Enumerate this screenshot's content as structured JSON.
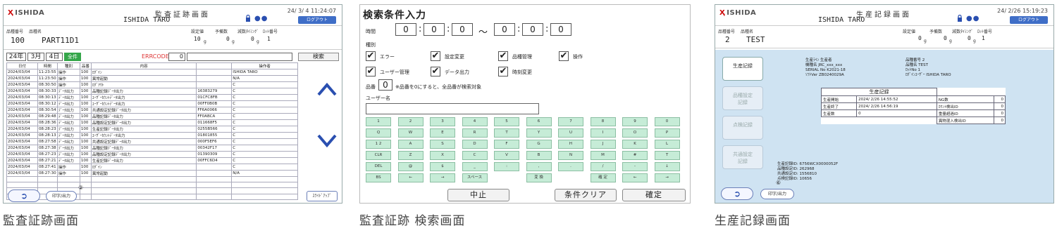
{
  "panels": {
    "audit": {
      "logo": "ISHIDA",
      "title": "監査証跡画面",
      "datetime": "24/ 3/ 4 11:24:07",
      "user": "ISHIDA TARO",
      "logout": "ログアウト",
      "header_labels": {
        "item_no": "品種番号",
        "item_name": "品種名",
        "set_weight": "設定値",
        "target": "予備数",
        "reduce": "減数ﾀｲﾐﾝｸﾞ",
        "lot": "ﾛｯﾄ番号"
      },
      "header_values": {
        "item_no": "100",
        "item_name": "PART11D1",
        "set_weight": "10",
        "target": "0",
        "reduce": "0",
        "lot": "1"
      },
      "unit": "g",
      "filter": {
        "year": "24年",
        "month": "3月",
        "day": "4日",
        "tag": "全件",
        "errcode_label": "ERRCODE",
        "errcode_value": "0",
        "search": "検索"
      },
      "columns": [
        "日付",
        "時間",
        "種別",
        "品番",
        "内容",
        "",
        "操作者"
      ],
      "rows": [
        [
          "2024/03/04",
          "11:23:55",
          "操作",
          "100",
          "ﾛｸﾞｲﾝ",
          "",
          "ISHIDA TARO"
        ],
        [
          "2024/03/04",
          "11:23:50",
          "操作",
          "100",
          "異常起動",
          "",
          "N/A"
        ],
        [
          "2024/03/04",
          "08:30:50",
          "操作",
          "100",
          "ﾛｸﾞｱｳﾄ",
          "",
          "C"
        ],
        [
          "2024/03/04",
          "08:30:33",
          "ﾃﾞｰﾀ出力",
          "100",
          "品種記録ﾃﾞｰﾀ出力",
          "16383279",
          "C"
        ],
        [
          "2024/03/04",
          "08:30:13",
          "ﾃﾞｰﾀ出力",
          "100",
          "ﾕｰｻﾞｰｶｳﾝﾄﾃﾞｰﾀ出力",
          "01CFC8FB",
          "C"
        ],
        [
          "2024/03/04",
          "08:30:12",
          "ﾃﾞｰﾀ出力",
          "100",
          "ﾕｰｻﾞｰｶｳﾝﾄﾃﾞｰﾀ出力",
          "00FF0B0B",
          "C"
        ],
        [
          "2024/03/04",
          "08:30:54",
          "ﾃﾞｰﾀ出力",
          "100",
          "共通設定記録ﾃﾞｰﾀ出力",
          "FF6A0066",
          "C"
        ],
        [
          "2024/03/04",
          "08:29:48",
          "ﾃﾞｰﾀ出力",
          "100",
          "品種記録ﾃﾞｰﾀ出力",
          "FF0ABCA",
          "C"
        ],
        [
          "2024/03/04",
          "08:28:36",
          "ﾃﾞｰﾀ出力",
          "100",
          "品種設定記録ﾃﾞｰﾀ出力",
          "011668F5",
          "C"
        ],
        [
          "2024/03/04",
          "08:28:23",
          "ﾃﾞｰﾀ出力",
          "100",
          "生産記録ﾃﾞｰﾀ出力",
          "0255B566",
          "C"
        ],
        [
          "2024/03/04",
          "08:28:13",
          "ﾃﾞｰﾀ出力",
          "100",
          "ﾕｰｻﾞｰｶｳﾝﾄﾃﾞｰﾀ出力",
          "01801855",
          "C"
        ],
        [
          "2024/03/04",
          "08:27:58",
          "ﾃﾞｰﾀ出力",
          "100",
          "共通設定記録ﾃﾞｰﾀ出力",
          "000F5EF6",
          "C"
        ],
        [
          "2024/03/04",
          "08:27:38",
          "ﾃﾞｰﾀ出力",
          "100",
          "品種記録ﾃﾞｰﾀ出力",
          "00342F17",
          "C"
        ],
        [
          "2024/03/04",
          "08:27:23",
          "ﾃﾞｰﾀ出力",
          "100",
          "品種設定記録ﾃﾞｰﾀ出力",
          "01390309",
          "C"
        ],
        [
          "2024/03/04",
          "08:27:21",
          "ﾃﾞｰﾀ出力",
          "100",
          "生産記録ﾃﾞｰﾀ出力",
          "00FFC6D4",
          "C"
        ],
        [
          "2024/03/04",
          "08:27:41",
          "操作",
          "100",
          "ﾛｸﾞｲﾝ",
          "",
          "C"
        ],
        [
          "2024/03/04",
          "08:27:30",
          "操作",
          "100",
          "異常起動",
          "",
          "N/A"
        ],
        [
          "",
          "",
          "",
          "",
          "",
          "",
          ""
        ],
        [
          "",
          "",
          "",
          "",
          "",
          "",
          ""
        ],
        [
          "",
          "",
          "",
          "",
          "",
          "",
          ""
        ],
        [
          "",
          "",
          "",
          "",
          "",
          "",
          ""
        ]
      ],
      "print_button": "印字/出力",
      "badge": "②",
      "slide_button": "ｽﾗｲﾄﾞｱｯﾌﾟ",
      "caption": "監査証跡画面"
    },
    "search": {
      "title": "検索条件入力",
      "time_label": "時間",
      "time_from": [
        "0",
        "0",
        "0"
      ],
      "time_to": [
        "0",
        "0",
        "0"
      ],
      "tilde": "〜",
      "type_label": "種別",
      "checks": [
        {
          "label": "エラー",
          "checked": "✔"
        },
        {
          "label": "設定変更",
          "checked": "✔"
        },
        {
          "label": "品種管理",
          "checked": "✔"
        },
        {
          "label": "操作",
          "checked": "✔"
        },
        {
          "label": "ユーザー管理",
          "checked": "✔"
        },
        {
          "label": "データ出力",
          "checked": "✔"
        },
        {
          "label": "時刻変更",
          "checked": "✔"
        }
      ],
      "item_label": "品番",
      "item_value": "0",
      "item_note": "※品番を0にすると、全品番が検索対象",
      "user_label": "ユーザー名",
      "user_value": "",
      "keys": [
        [
          "1",
          "2",
          "3",
          "4",
          "5",
          "6",
          "7",
          "8",
          "9",
          "0"
        ],
        [
          "Q",
          "W",
          "E",
          "R",
          "T",
          "Y",
          "U",
          "I",
          "O",
          "P"
        ],
        [
          "1 2",
          "A",
          "S",
          "D",
          "F",
          "G",
          "H",
          "J",
          "K",
          "L"
        ],
        [
          "CLR",
          "Z",
          "X",
          "C",
          "V",
          "B",
          "N",
          "M",
          "#",
          "T"
        ],
        [
          "DEL",
          "@",
          "$",
          "_",
          ":",
          ",",
          ".",
          "/",
          "-",
          "↓"
        ],
        [
          "BS",
          "←",
          "→",
          "スペース",
          "",
          "変 換",
          "",
          "確 定",
          "←",
          "→"
        ]
      ],
      "cancel": "中止",
      "clear": "条件クリア",
      "ok": "確定",
      "caption": "監査証跡 検索画面"
    },
    "production": {
      "logo": "ISHIDA",
      "title": "生産記録画面",
      "datetime": "24/ 2/26 15:19:23",
      "user": "ISHIDA TARO",
      "logout": "ログアウト",
      "header_labels": {
        "item_no": "品種番号",
        "item_name": "品種名",
        "set_weight": "設定値",
        "target": "予備数",
        "reduce": "減数ﾀｲﾐﾝｸﾞ",
        "lot": "ﾛｯﾄ番号"
      },
      "header_values": {
        "item_no": "2",
        "item_name": "TEST",
        "set_weight": "0",
        "target": "0",
        "reduce": "0",
        "lot": "1"
      },
      "unit": "g",
      "menu": [
        "生産記録",
        "品種設定\n記録",
        "点検記録",
        "共通設定\n記録"
      ],
      "info_left": [
        "生産ﾗｲﾝ   生産者",
        "機種名     JRC_xxx_xxx",
        "SERIAL No  K2021-18",
        "ｿﾌﾄVer    ZB0240029A"
      ],
      "info_right": [
        "品種番号   2",
        "品種名     TEST",
        "ﾛｯﾄNo    1",
        "ﾛｸﾞｲﾝﾕｰｻﾞｰ  ISHIDA TARO"
      ],
      "record_title": "生産記録",
      "record_rows": [
        {
          "k": "生産開始",
          "v": "2024/ 2/26  14:55:52"
        },
        {
          "k": "生産終了",
          "v": "2024/ 2/26  14:56:19"
        },
        {
          "k": "生産数",
          "v": "0"
        }
      ],
      "reject_title": "内訳",
      "reject_rows": [
        {
          "k": "NG数",
          "v": "0"
        },
        {
          "k": "ｶｳﾝﾄ検出ID",
          "v": "0"
        },
        {
          "k": "重量超過ID",
          "v": "0"
        },
        {
          "k": "異物混入検出ID",
          "v": "0"
        }
      ],
      "footer_info": [
        "生産記録ID: 6756WCX0000052F",
        "品種設定ID: 262968",
        "共通設定ID: 1556810",
        "点検記録ID: 10656"
      ],
      "print_button": "印字/出力",
      "badge": "⑥",
      "caption": "生産記録画面"
    }
  }
}
